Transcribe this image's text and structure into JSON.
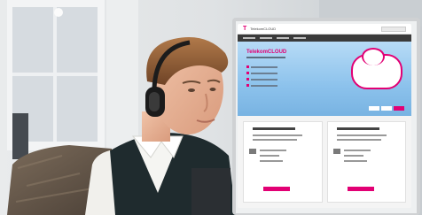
{
  "photo": {
    "subject": "",
    "screen": {
      "logo": "T",
      "brand": "TelekomCLOUD",
      "hero_title": "TelekomCLOUD"
    }
  },
  "colors": {
    "brand_magenta": "#e20074"
  }
}
